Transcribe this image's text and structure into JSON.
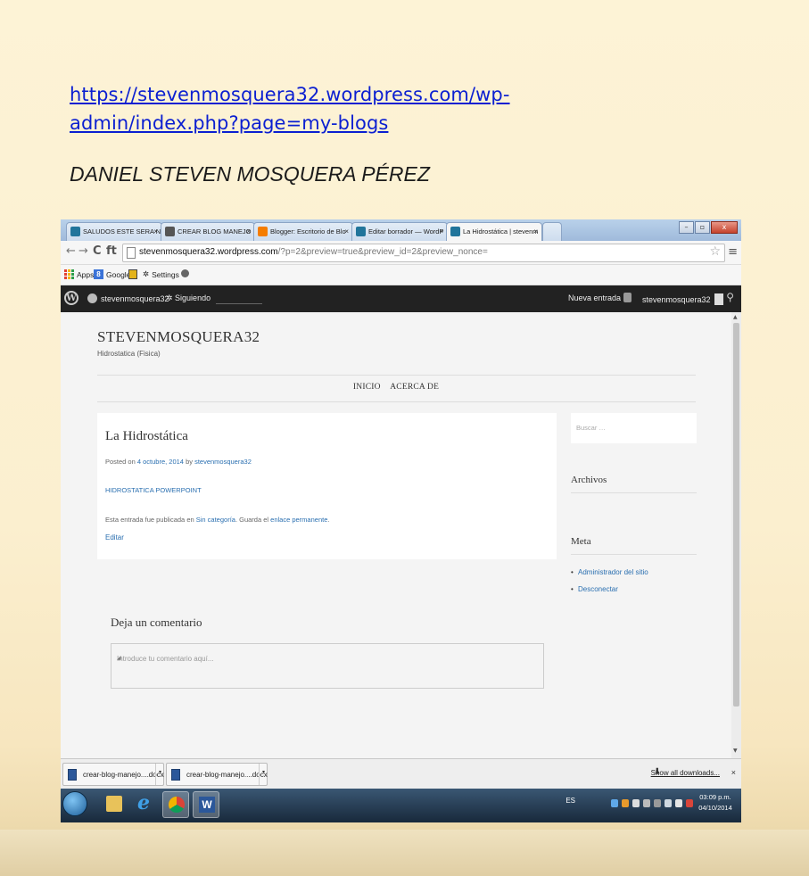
{
  "document": {
    "link_text": "https://stevenmosquera32.wordpress.com/wp-admin/index.php?page=my-blogs",
    "author": "DANIEL STEVEN MOSQUERA PÉREZ"
  },
  "browser": {
    "tabs": [
      {
        "label": "SALUDOS ESTE SERA NUE",
        "active": false,
        "icon_color": "#21759b"
      },
      {
        "label": "CREAR BLOG MANEJO SLI",
        "active": false,
        "icon_color": "#555555"
      },
      {
        "label": "Blogger: Escritorio de Blo",
        "active": false,
        "icon_color": "#f57d00"
      },
      {
        "label": "Editar borrador — WordP",
        "active": false,
        "icon_color": "#21759b"
      },
      {
        "label": "La Hidrostática | stevenm",
        "active": true,
        "icon_color": "#21759b"
      }
    ],
    "tab_close": "×",
    "window_controls": [
      "–",
      "▫",
      "x"
    ],
    "nav": {
      "back": "←",
      "forward": "→",
      "reload": "C",
      "home": "ft"
    },
    "url_host": "stevenmosquera32.wordpress.com",
    "url_rest": "/?p=2&preview=true&preview_id=2&preview_nonce=",
    "star": "☆",
    "menu": "≡",
    "bookmarks": {
      "apps": "Apps",
      "google": "Google",
      "settings": "Settings"
    }
  },
  "wp_admin_bar": {
    "site": "stevenmosquera32",
    "following": "Siguiendo",
    "new_post": "Nueva entrada",
    "user": "stevenmosquera32",
    "search_glyph": "⚲"
  },
  "site": {
    "title": "STEVENMOSQUERA32",
    "description": "Hidrostatica (Fisica)",
    "menu": [
      "INICIO",
      "ACERCA DE"
    ]
  },
  "post": {
    "title": "La Hidrostática",
    "meta_prefix": "Posted on ",
    "meta_date": "4 octubre, 2014",
    "meta_by": " by ",
    "meta_author": "stevenmosquera32",
    "link": "HIDROSTATICA POWERPOINT",
    "footer_prefix": "Esta entrada fue publicada en ",
    "footer_category": "Sin categoría",
    "footer_mid": ". Guarda el ",
    "footer_permalink": "enlace permanente",
    "footer_end": ".",
    "edit": "Editar"
  },
  "sidebar": {
    "search_placeholder": "Buscar …",
    "archives_title": "Archivos",
    "meta_title": "Meta",
    "meta_items": [
      "Administrador del sitio",
      "Desconectar"
    ]
  },
  "comments": {
    "title": "Deja un comentario",
    "placeholder": "Introduce tu comentario aquí..."
  },
  "downloads": {
    "items": [
      "crear-blog-manejo....docx",
      "crear-blog-manejo....docx"
    ],
    "show_all": "Show all downloads...",
    "close": "×"
  },
  "taskbar": {
    "lang": "ES",
    "time": "03:09 p.m.",
    "date": "04/10/2014"
  }
}
